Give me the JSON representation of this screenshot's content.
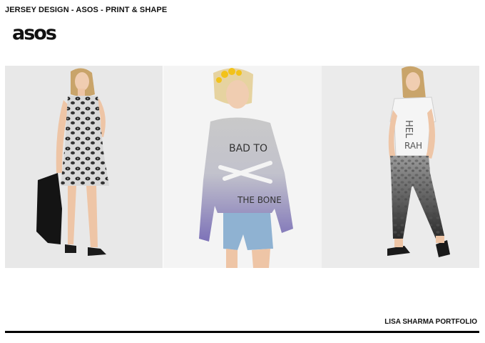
{
  "header": {
    "title": "JERSEY DESIGN - ASOS - PRINT & SHAPE",
    "logo_text": "asos"
  },
  "photos": [
    {
      "name": "photo-leopard-print-dress"
    },
    {
      "name": "photo-dip-dye-sweatshirt",
      "print_text": [
        "BAD TO",
        "THE BONE"
      ]
    },
    {
      "name": "photo-slogan-tee-leopard-joggers"
    }
  ],
  "footer": {
    "label": "LISA SHARMA PORTFOLIO"
  }
}
